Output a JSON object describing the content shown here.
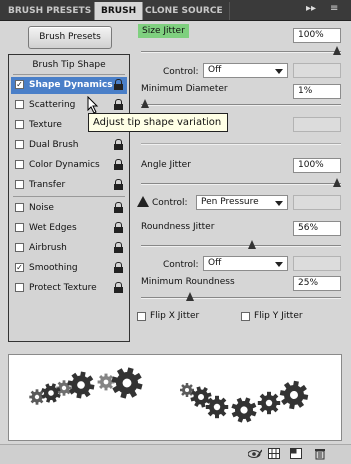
{
  "tabs": [
    {
      "label": "BRUSH PRESETS",
      "active": false
    },
    {
      "label": "BRUSH",
      "active": true
    },
    {
      "label": "CLONE SOURCE",
      "active": false
    }
  ],
  "panel_menu_icon": "double-arrow-menu-icon",
  "brush_presets_button": "Brush Presets",
  "left_header": "Brush Tip Shape",
  "left_items": [
    {
      "label": "Shape Dynamics",
      "checked": true,
      "selected": true
    },
    {
      "label": "Scattering",
      "checked": false
    },
    {
      "label": "Texture",
      "checked": false
    },
    {
      "label": "Dual Brush",
      "checked": false
    },
    {
      "label": "Color Dynamics",
      "checked": false
    },
    {
      "label": "Transfer",
      "checked": false
    },
    {
      "label": "Noise",
      "checked": false
    },
    {
      "label": "Wet Edges",
      "checked": false
    },
    {
      "label": "Airbrush",
      "checked": false
    },
    {
      "label": "Smoothing",
      "checked": true
    },
    {
      "label": "Protect Texture",
      "checked": false
    }
  ],
  "tooltip": "Adjust tip shape variation",
  "size_jitter": {
    "label": "Size Jitter",
    "value": "100%",
    "slider": 1.0
  },
  "control1": {
    "label": "Control:",
    "value": "Off"
  },
  "min_diameter": {
    "label": "Minimum Diameter",
    "value": "1%",
    "slider": 0.01
  },
  "angle_jitter": {
    "label": "Angle Jitter",
    "value": "100%",
    "slider": 1.0
  },
  "control2": {
    "label": "Control:",
    "value": "Pen Pressure"
  },
  "roundness_jitter": {
    "label": "Roundness Jitter",
    "value": "56%",
    "slider": 0.56
  },
  "control3": {
    "label": "Control:",
    "value": "Off"
  },
  "min_roundness": {
    "label": "Minimum Roundness",
    "value": "25%",
    "slider": 0.25
  },
  "flip_x": {
    "label": "Flip X Jitter",
    "checked": false
  },
  "flip_y": {
    "label": "Flip Y Jitter",
    "checked": false
  },
  "preview_icon": "gear-brush-stroke-preview",
  "bottom_icons": [
    "eye-brush-icon",
    "grid-icon",
    "new-preset-icon",
    "trash-icon"
  ]
}
